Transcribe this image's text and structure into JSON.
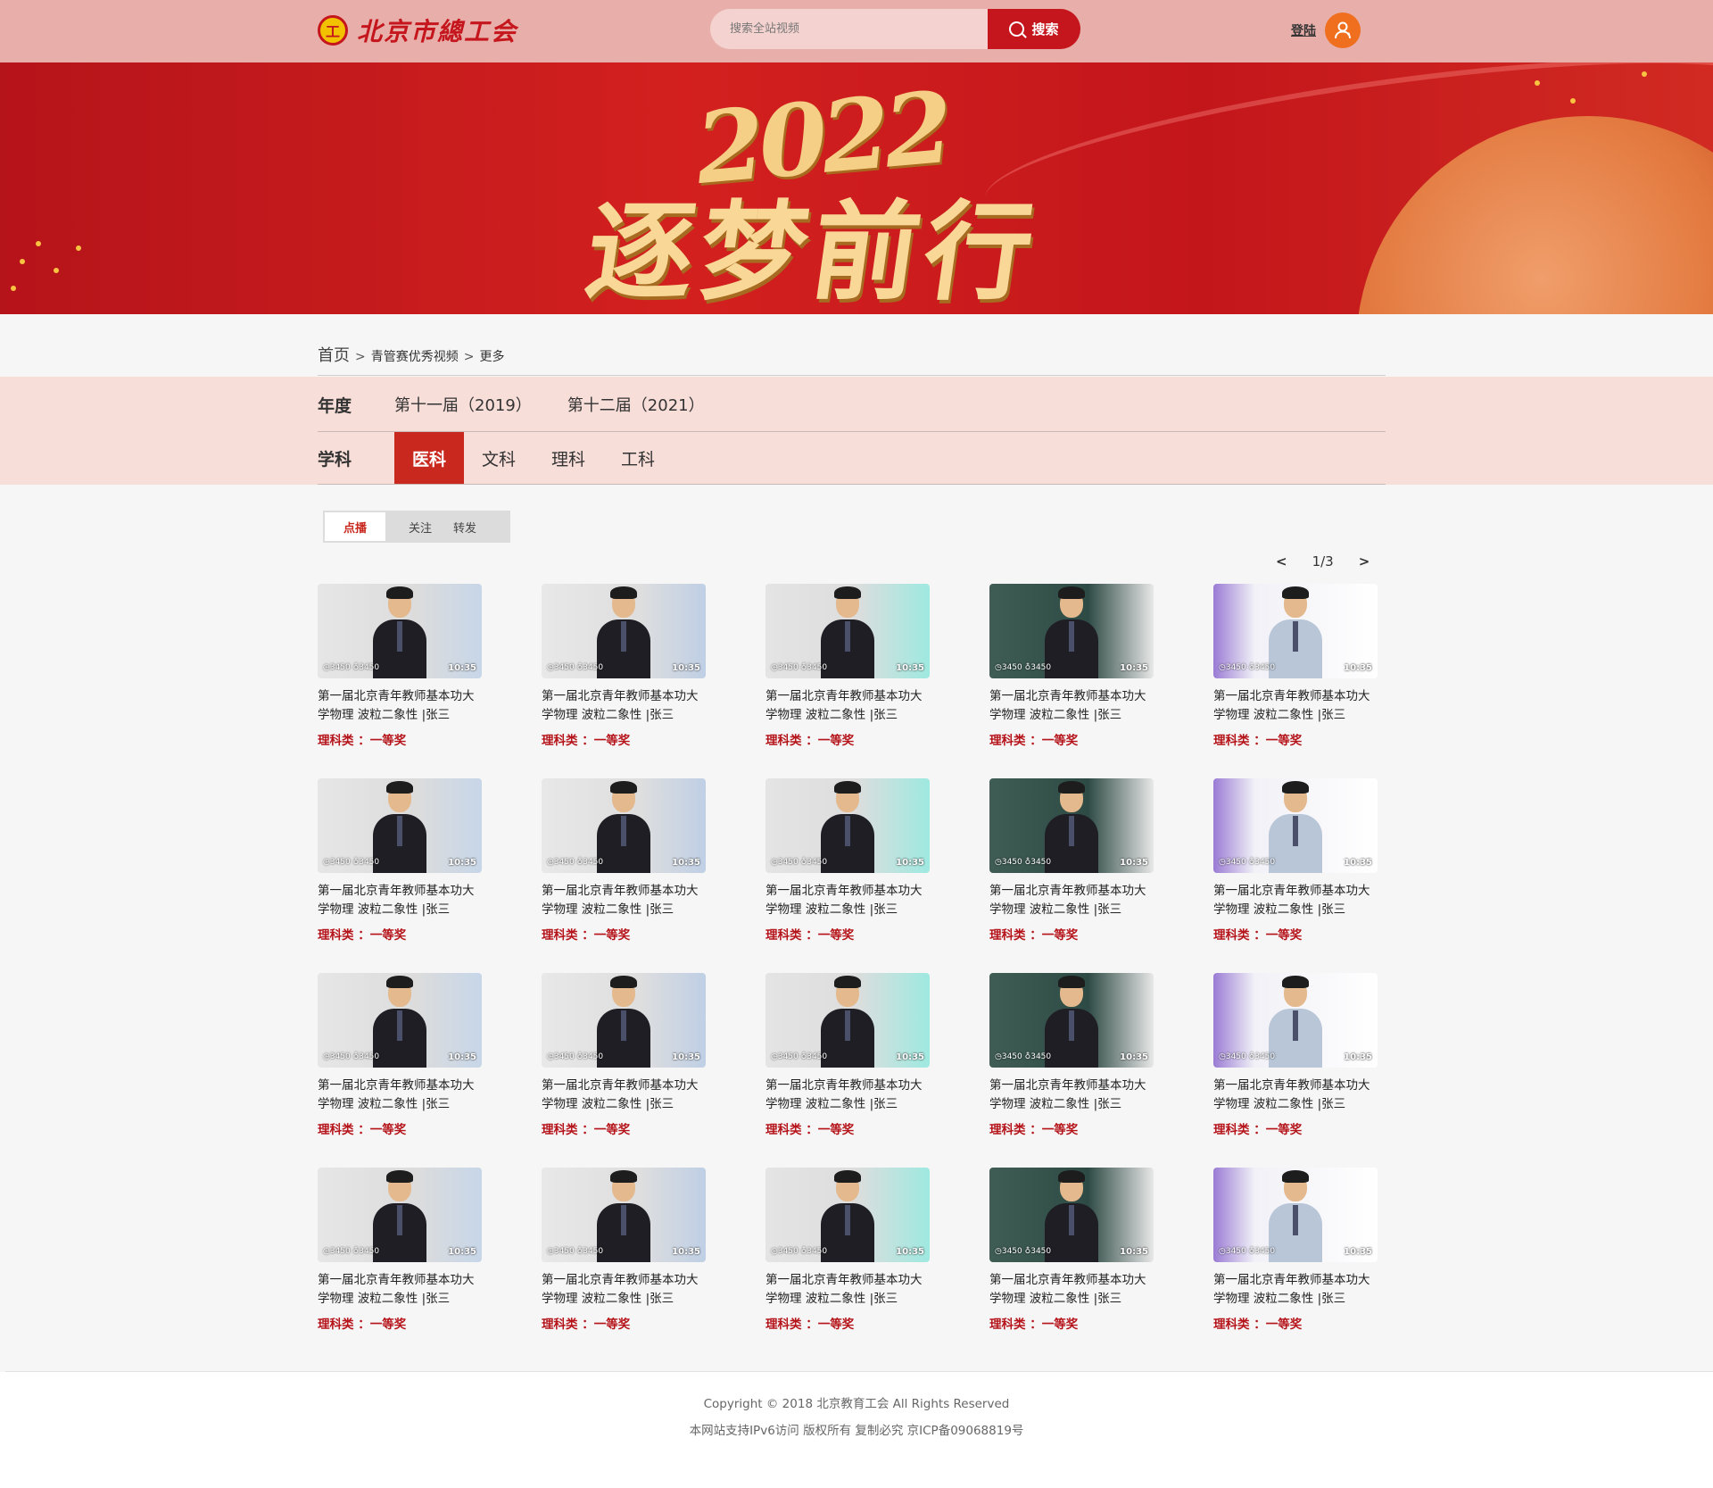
{
  "header": {
    "logo_text": "北京市總工会",
    "search_placeholder": "搜索全站视频",
    "search_label": "搜索",
    "login_label": "登陆"
  },
  "banner": {
    "year": "2022",
    "slogan": "逐梦前行"
  },
  "breadcrumb": {
    "home": "首页",
    "level1": "青管赛优秀视频",
    "level2": "更多"
  },
  "filter": {
    "year_label": "年度",
    "years": [
      "第十一届（2019）",
      "第十二届（2021）"
    ],
    "subject_label": "学科",
    "subjects": [
      "医科",
      "文科",
      "理科",
      "工科"
    ],
    "active_subject": "医科"
  },
  "sort_tabs": [
    "点播",
    "关注",
    "转发"
  ],
  "pager": {
    "prev": "<",
    "current": "1/3",
    "next": ">"
  },
  "videos": [
    {
      "title": "第一届北京青年教师基本功大学物理 波粒二象性 |张三",
      "tag": "理科类 ：一等奖",
      "views": "3450",
      "likes": "3450",
      "duration": "10:35"
    },
    {
      "title": "第一届北京青年教师基本功大学物理 波粒二象性 |张三",
      "tag": "理科类 ：一等奖",
      "views": "3450",
      "likes": "3450",
      "duration": "10:35"
    },
    {
      "title": "第一届北京青年教师基本功大学物理 波粒二象性 |张三",
      "tag": "理科类 ：一等奖",
      "views": "3450",
      "likes": "3450",
      "duration": "10:35"
    },
    {
      "title": "第一届北京青年教师基本功大学物理 波粒二象性 |张三",
      "tag": "理科类 ：一等奖",
      "views": "3450",
      "likes": "3450",
      "duration": "10:35"
    },
    {
      "title": "第一届北京青年教师基本功大学物理 波粒二象性 |张三",
      "tag": "理科类 ：一等奖",
      "views": "3450",
      "likes": "3450",
      "duration": "10:35"
    },
    {
      "title": "第一届北京青年教师基本功大学物理 波粒二象性 |张三",
      "tag": "理科类 ：一等奖",
      "views": "3450",
      "likes": "3450",
      "duration": "10:35"
    },
    {
      "title": "第一届北京青年教师基本功大学物理 波粒二象性 |张三",
      "tag": "理科类 ：一等奖",
      "views": "3450",
      "likes": "3450",
      "duration": "10:35"
    },
    {
      "title": "第一届北京青年教师基本功大学物理 波粒二象性 |张三",
      "tag": "理科类 ：一等奖",
      "views": "3450",
      "likes": "3450",
      "duration": "10:35"
    },
    {
      "title": "第一届北京青年教师基本功大学物理 波粒二象性 |张三",
      "tag": "理科类 ：一等奖",
      "views": "3450",
      "likes": "3450",
      "duration": "10:35"
    },
    {
      "title": "第一届北京青年教师基本功大学物理 波粒二象性 |张三",
      "tag": "理科类 ：一等奖",
      "views": "3450",
      "likes": "3450",
      "duration": "10:35"
    },
    {
      "title": "第一届北京青年教师基本功大学物理 波粒二象性 |张三",
      "tag": "理科类 ：一等奖",
      "views": "3450",
      "likes": "3450",
      "duration": "10:35"
    },
    {
      "title": "第一届北京青年教师基本功大学物理 波粒二象性 |张三",
      "tag": "理科类 ：一等奖",
      "views": "3450",
      "likes": "3450",
      "duration": "10:35"
    },
    {
      "title": "第一届北京青年教师基本功大学物理 波粒二象性 |张三",
      "tag": "理科类 ：一等奖",
      "views": "3450",
      "likes": "3450",
      "duration": "10:35"
    },
    {
      "title": "第一届北京青年教师基本功大学物理 波粒二象性 |张三",
      "tag": "理科类 ：一等奖",
      "views": "3450",
      "likes": "3450",
      "duration": "10:35"
    },
    {
      "title": "第一届北京青年教师基本功大学物理 波粒二象性 |张三",
      "tag": "理科类 ：一等奖",
      "views": "3450",
      "likes": "3450",
      "duration": "10:35"
    },
    {
      "title": "第一届北京青年教师基本功大学物理 波粒二象性 |张三",
      "tag": "理科类 ：一等奖",
      "views": "3450",
      "likes": "3450",
      "duration": "10:35"
    },
    {
      "title": "第一届北京青年教师基本功大学物理 波粒二象性 |张三",
      "tag": "理科类 ：一等奖",
      "views": "3450",
      "likes": "3450",
      "duration": "10:35"
    },
    {
      "title": "第一届北京青年教师基本功大学物理 波粒二象性 |张三",
      "tag": "理科类 ：一等奖",
      "views": "3450",
      "likes": "3450",
      "duration": "10:35"
    },
    {
      "title": "第一届北京青年教师基本功大学物理 波粒二象性 |张三",
      "tag": "理科类 ：一等奖",
      "views": "3450",
      "likes": "3450",
      "duration": "10:35"
    },
    {
      "title": "第一届北京青年教师基本功大学物理 波粒二象性 |张三",
      "tag": "理科类 ：一等奖",
      "views": "3450",
      "likes": "3450",
      "duration": "10:35"
    }
  ],
  "footer": {
    "copyright": "Copyright © 2018 北京教育工会  All Rights Reserved",
    "notice": "本网站支持IPv6访问 版权所有 复制必究 京ICP备09068819号"
  },
  "colors": {
    "accent": "#c8281e",
    "header_bg": "#e8aeaa",
    "filter_bg": "#f8ded9",
    "avatar": "#ef6f1e"
  }
}
